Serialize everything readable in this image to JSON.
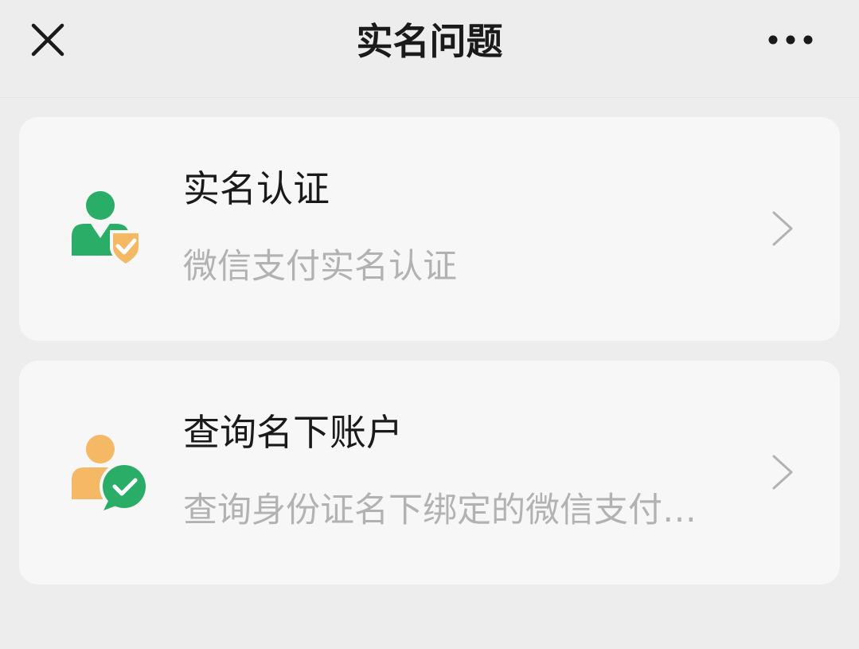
{
  "header": {
    "title": "实名问题",
    "close_icon": "close-icon",
    "more_icon": "more-horizontal-icon"
  },
  "items": [
    {
      "title": "实名认证",
      "subtitle": "微信支付实名认证",
      "icon": "user-shield-check-icon"
    },
    {
      "title": "查询名下账户",
      "subtitle": "查询身份证名下绑定的微信支付账户",
      "icon": "user-wechat-check-icon"
    }
  ],
  "colors": {
    "background": "#ededed",
    "card": "#f7f7f7",
    "title_text": "#1a1a1a",
    "subtitle_text": "#b2b2b2",
    "green": "#2aae67",
    "orange": "#f5b865"
  }
}
